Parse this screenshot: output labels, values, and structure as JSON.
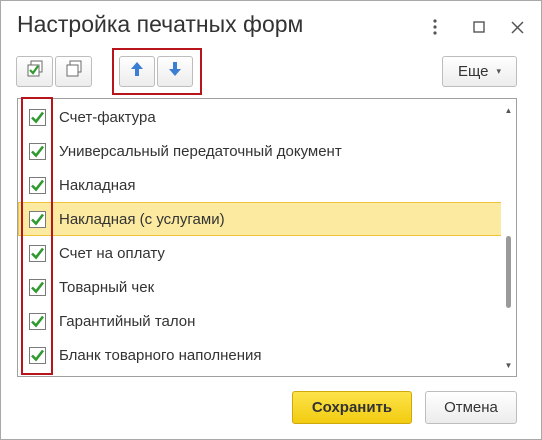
{
  "window": {
    "title": "Настройка печатных форм"
  },
  "titlebar": {
    "menu_icon": "more-vertical-icon",
    "maximize_icon": "maximize-icon",
    "close_icon": "close-icon"
  },
  "toolbar": {
    "check_all_icon": "check-all-icon",
    "uncheck_all_icon": "uncheck-all-icon",
    "move_up_icon": "arrow-up-icon",
    "move_down_icon": "arrow-down-icon",
    "more_label": "Еще",
    "more_caret": "▾"
  },
  "list": {
    "items": [
      {
        "label": "Счет-фактура",
        "checked": true
      },
      {
        "label": "Универсальный передаточный документ",
        "checked": true
      },
      {
        "label": "Накладная",
        "checked": true
      },
      {
        "label": "Накладная (с услугами)",
        "checked": true,
        "selected": true
      },
      {
        "label": "Счет на оплату",
        "checked": true
      },
      {
        "label": "Товарный чек",
        "checked": true
      },
      {
        "label": "Гарантийный талон",
        "checked": true
      },
      {
        "label": "Бланк товарного наполнения",
        "checked": true
      }
    ]
  },
  "footer": {
    "save_label": "Сохранить",
    "cancel_label": "Отмена"
  },
  "colors": {
    "check": "#2f9a2f",
    "arrow": "#3b7fd4",
    "highlight": "#b8141b",
    "primary": "#f6d51c",
    "selected_row": "#fbeaa0"
  }
}
